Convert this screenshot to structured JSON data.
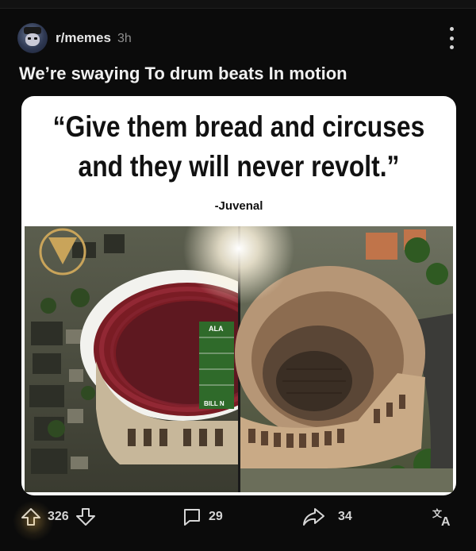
{
  "post": {
    "subreddit": "r/memes",
    "age": "3h",
    "title": "We’re swaying To drum beats In motion"
  },
  "image": {
    "quote_line1": "“Give them bread and circuses",
    "quote_line2": "and they will never revolt.”",
    "attribution": "-Juvenal",
    "stadium_sign": "ALA",
    "stadium_sign2": "BILL N"
  },
  "actions": {
    "upvotes": "326",
    "comments": "29",
    "shares": "34"
  },
  "icons": [
    "avatar",
    "more-options-icon",
    "upvote-icon",
    "downvote-icon",
    "comment-icon",
    "share-icon",
    "translate-icon"
  ]
}
